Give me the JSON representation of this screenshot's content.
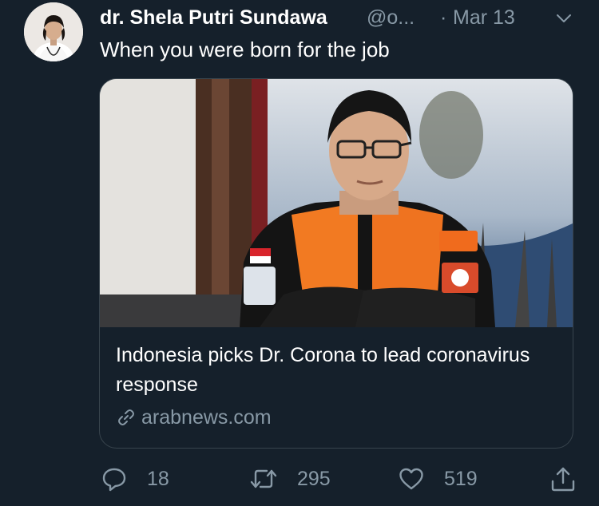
{
  "tweet": {
    "author": {
      "display_name": "dr. Shela Putri Sundawa",
      "handle": "@o...",
      "avatar_icon": "avatar-photo"
    },
    "separator": "·",
    "date": "Mar 13",
    "text": "When you were born for the job",
    "menu_icon": "chevron-down-icon"
  },
  "card": {
    "image_icon": "article-photo",
    "title": "Indonesia picks Dr. Corona to lead coronavirus response",
    "link_icon": "link-icon",
    "domain": "arabnews.com"
  },
  "actions": {
    "reply": {
      "icon": "reply-icon",
      "count": "18"
    },
    "retweet": {
      "icon": "retweet-icon",
      "count": "295"
    },
    "like": {
      "icon": "heart-icon",
      "count": "519"
    },
    "share": {
      "icon": "share-icon"
    }
  },
  "colors": {
    "background": "#15202b",
    "primary_text": "#ffffff",
    "secondary_text": "#8899a6",
    "border": "#38444d"
  }
}
